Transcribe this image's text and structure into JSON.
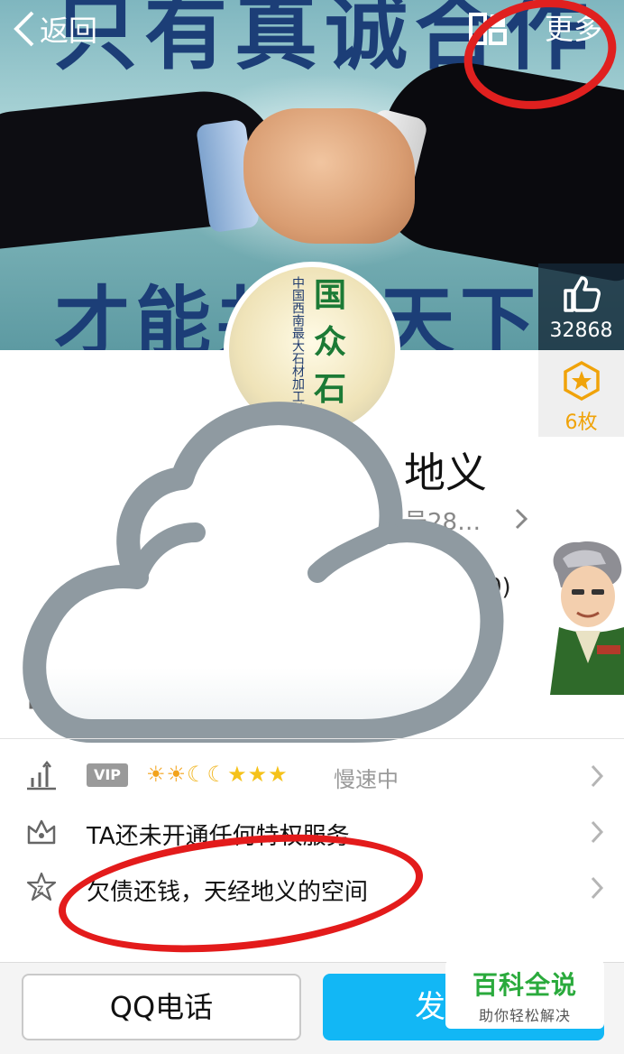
{
  "cover": {
    "top_text": "只有真诚合作",
    "bottom_text": "才能共赢天下"
  },
  "topbar": {
    "back_label": "返回",
    "more_label": "更多"
  },
  "side": {
    "like_count": "32868",
    "badge_count": "6枚"
  },
  "avatar": {
    "vertical_text": "中国西南最大石材加工基地",
    "chars": [
      "国",
      "众",
      "石"
    ]
  },
  "profile": {
    "name_fragment": "地义",
    "sub_fragment": "号28…",
    "paren_fragment": "0)"
  },
  "rows": [
    {
      "vip_label": "VIP",
      "level_icons": "☀☀☾☾★★★",
      "status": "慢速中"
    },
    {
      "text": "TA还未开通任何特权服务"
    },
    {
      "text": "欠债还钱，天经地义的空间"
    }
  ],
  "bottom": {
    "phone_label": "QQ电话",
    "send_label": "发"
  },
  "watermark": {
    "title": "百科全说",
    "subtitle": "助你轻松解决"
  },
  "colors": {
    "accent_blue": "#12b7f5",
    "annotation_red": "#e31b1b",
    "badge_orange": "#f0a30a",
    "watermark_green": "#2aaa3c"
  }
}
